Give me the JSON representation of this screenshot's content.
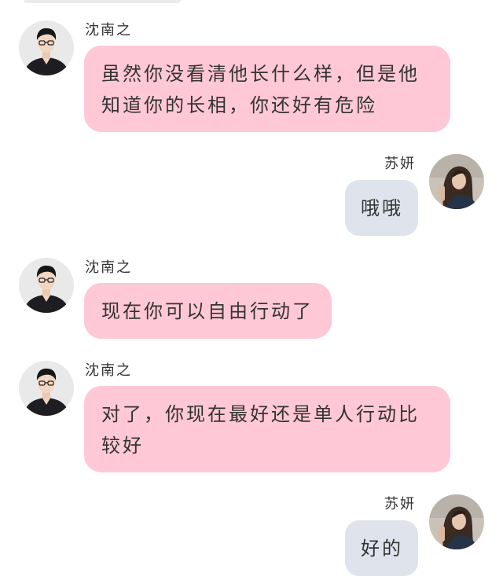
{
  "chat": {
    "messages": [
      {
        "sender": "沈南之",
        "side": "left",
        "avatar_icon": "man-with-glasses-avatar-icon",
        "lines": [
          "虽然你没看清他长什么样，但是他",
          "知道你的长相，你还好有危险"
        ]
      },
      {
        "sender": "苏妍",
        "side": "right",
        "avatar_icon": "woman-long-hair-avatar-icon",
        "lines": [
          "哦哦"
        ]
      },
      {
        "sender": "沈南之",
        "side": "left",
        "avatar_icon": "man-with-glasses-avatar-icon",
        "lines": [
          "现在你可以自由行动了"
        ]
      },
      {
        "sender": "沈南之",
        "side": "left",
        "avatar_icon": "man-with-glasses-avatar-icon",
        "lines": [
          "对了，你现在最好还是单人行动比",
          "较好"
        ]
      },
      {
        "sender": "苏妍",
        "side": "right",
        "avatar_icon": "woman-long-hair-avatar-icon",
        "lines": [
          "好的"
        ]
      }
    ]
  },
  "colors": {
    "left_bubble": "#ffc8d6",
    "right_bubble": "#dfe4ec",
    "text": "#333333",
    "background": "#ffffff"
  }
}
